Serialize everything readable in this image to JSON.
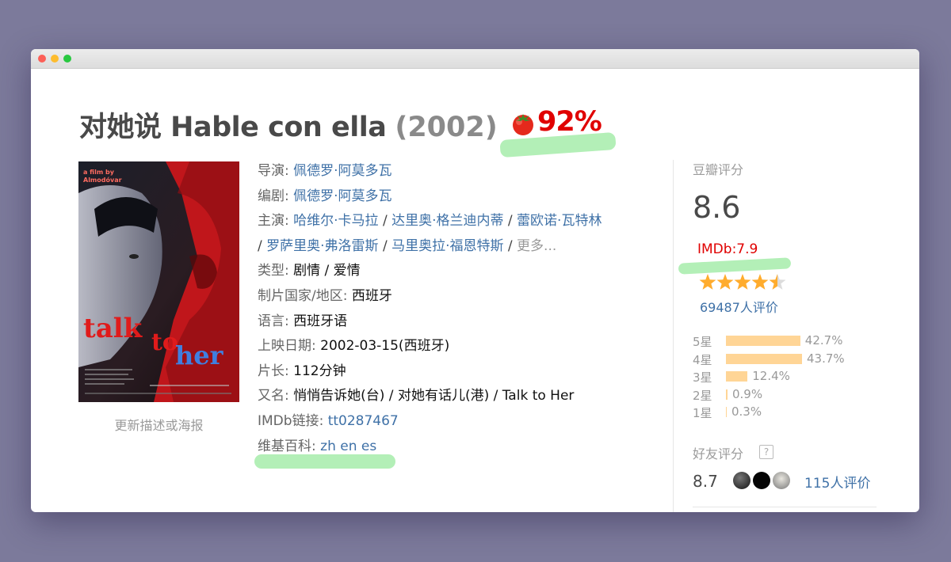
{
  "window": {
    "controls": [
      "close",
      "minimize",
      "maximize"
    ]
  },
  "movie": {
    "title": "对她说 Hable con ella",
    "year": "(2002)",
    "rt_score": "92%",
    "rt_icon": "tomato-icon"
  },
  "poster": {
    "caption": "更新描述或海报",
    "text_top": "a film by",
    "text_director": "Almodóvar",
    "text_title_1": "talk",
    "text_title_2": "to",
    "text_title_3": "her"
  },
  "info": {
    "director_label": "导演",
    "director": "佩德罗·阿莫多瓦",
    "writer_label": "编剧",
    "writer": "佩德罗·阿莫多瓦",
    "cast_label": "主演",
    "cast": [
      "哈维尔·卡马拉",
      "达里奥·格兰迪内蒂",
      "蕾欧诺·瓦特林",
      "罗萨里奥·弗洛雷斯",
      "马里奥拉·福恩特斯"
    ],
    "cast_more": "更多...",
    "genre_label": "类型",
    "genre": "剧情 / 爱情",
    "country_label": "制片国家/地区",
    "country": "西班牙",
    "language_label": "语言",
    "language": "西班牙语",
    "release_label": "上映日期",
    "release": "2002-03-15(西班牙)",
    "runtime_label": "片长",
    "runtime": "112分钟",
    "aka_label": "又名",
    "aka": "悄悄告诉她(台) / 对她有话儿(港) / Talk to Her",
    "imdb_label": "IMDb链接",
    "imdb_id": "tt0287467",
    "wiki_label": "维基百科",
    "wiki_langs": [
      "zh",
      "en",
      "es"
    ]
  },
  "rating": {
    "section_title": "豆瓣评分",
    "score": "8.6",
    "imdb": "IMDb:7.9",
    "stars_value": 4.5,
    "stars_max": 5,
    "votes": "69487人评价",
    "distribution": [
      {
        "label": "5星",
        "pct": "42.7%",
        "value": 42.7
      },
      {
        "label": "4星",
        "pct": "43.7%",
        "value": 43.7
      },
      {
        "label": "3星",
        "pct": "12.4%",
        "value": 12.4
      },
      {
        "label": "2星",
        "pct": "0.9%",
        "value": 0.9
      },
      {
        "label": "1星",
        "pct": "0.3%",
        "value": 0.3
      }
    ],
    "star_color": "#ffac2d",
    "bar_color": "#ffd596"
  },
  "friends": {
    "section_title": "好友评分",
    "help": "?",
    "score": "8.7",
    "votes": "115人评价"
  },
  "colors": {
    "link": "#3f71a7",
    "rt_red": "#e00000",
    "highlight": "#a6ecaa"
  }
}
